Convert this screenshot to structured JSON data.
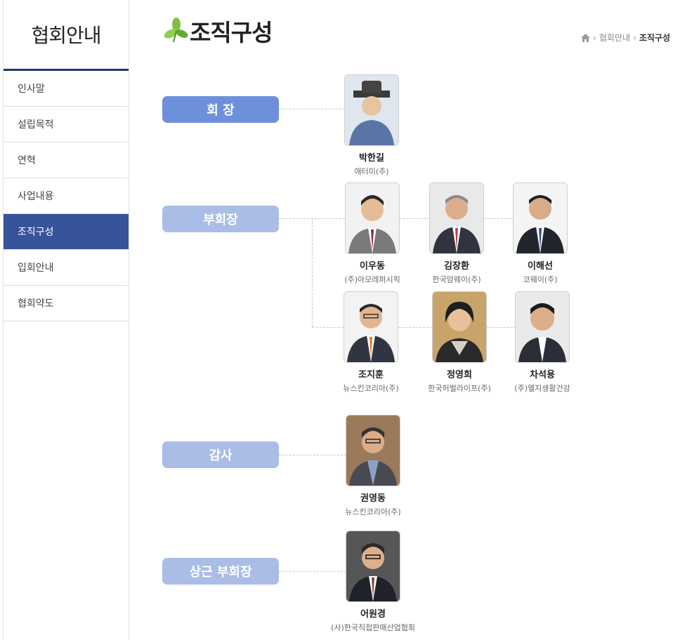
{
  "sidebar": {
    "title": "협회안내",
    "items": [
      {
        "label": "인사말"
      },
      {
        "label": "설립목적"
      },
      {
        "label": "연혁"
      },
      {
        "label": "사업내용"
      },
      {
        "label": "조직구성"
      },
      {
        "label": "입회안내"
      },
      {
        "label": "협회약도"
      }
    ],
    "active_index": 4
  },
  "header": {
    "title": "조직구성",
    "breadcrumb": {
      "parent": "협회안내",
      "current": "조직구성"
    },
    "icons": {
      "title": "leaf-icon",
      "breadcrumb": "home-icon"
    }
  },
  "colors": {
    "sidebar_active": "#37539a",
    "sidebar_rule": "#24376b",
    "role_chair": "#6e90db",
    "role_other": "#a9bde6"
  },
  "org": {
    "roles": {
      "chair": "회 장",
      "vice": "부회장",
      "auditor": "감사",
      "standing_vice": "상근 부회장"
    },
    "chair": [
      {
        "name": "박한길",
        "org": "애터미(주)"
      }
    ],
    "vice": [
      {
        "name": "이우동",
        "org": "(주)아모레퍼시픽"
      },
      {
        "name": "김장환",
        "org": "한국암웨이(주)"
      },
      {
        "name": "이해선",
        "org": "코웨이(주)"
      },
      {
        "name": "조지훈",
        "org": "뉴스킨코리아(주)"
      },
      {
        "name": "정영희",
        "org": "한국허벌라이프(주)"
      },
      {
        "name": "차석용",
        "org": "(주)엘지생활건강"
      }
    ],
    "auditor": [
      {
        "name": "권영동",
        "org": "뉴스킨코리아(주)"
      }
    ],
    "standing_vice": [
      {
        "name": "어원경",
        "org": "(사)한국직접판매산업협회"
      }
    ]
  }
}
